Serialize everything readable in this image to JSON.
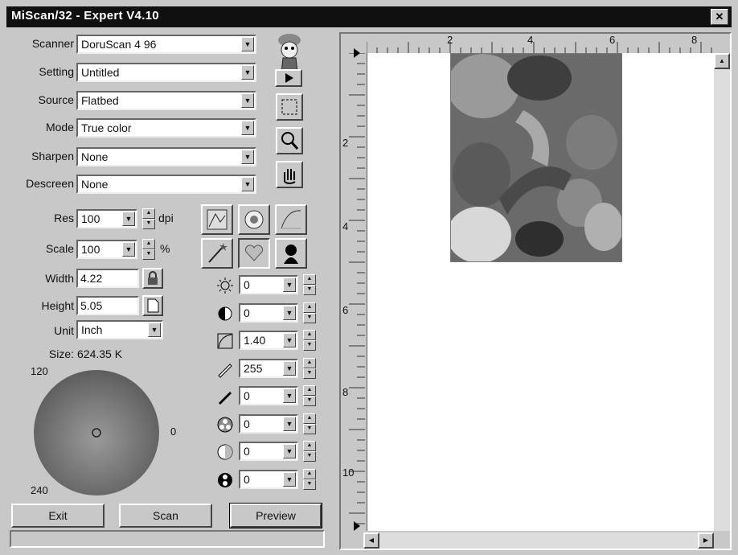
{
  "window": {
    "title": "MiScan/32 - Expert V4.10",
    "close_glyph": "✕"
  },
  "form": {
    "scanner": {
      "label": "Scanner",
      "value": "DoruScan 4 96"
    },
    "setting": {
      "label": "Setting",
      "value": "Untitled"
    },
    "source": {
      "label": "Source",
      "value": "Flatbed"
    },
    "mode": {
      "label": "Mode",
      "value": "True color"
    },
    "sharpen": {
      "label": "Sharpen",
      "value": "None"
    },
    "descreen": {
      "label": "Descreen",
      "value": "None"
    },
    "res": {
      "label": "Res",
      "value": "100",
      "unit": "dpi"
    },
    "scale": {
      "label": "Scale",
      "value": "100",
      "unit": "%"
    },
    "width": {
      "label": "Width",
      "value": "4.22"
    },
    "height": {
      "label": "Height",
      "value": "5.05"
    },
    "unit": {
      "label": "Unit",
      "value": "Inch"
    },
    "size": {
      "label": "Size:",
      "value": "624.35 K"
    }
  },
  "color_wheel": {
    "label_120": "120",
    "label_0": "0",
    "label_240": "240"
  },
  "adjustments": [
    {
      "icon": "brightness-icon",
      "value": "0"
    },
    {
      "icon": "contrast-icon",
      "value": "0"
    },
    {
      "icon": "gamma-icon",
      "value": "1.40"
    },
    {
      "icon": "white-point-icon",
      "value": "255"
    },
    {
      "icon": "black-point-icon",
      "value": "0"
    },
    {
      "icon": "saturation-icon",
      "value": "0"
    },
    {
      "icon": "hue-icon",
      "value": "0"
    },
    {
      "icon": "color-balance-icon",
      "value": "0"
    }
  ],
  "buttons": {
    "exit": "Exit",
    "scan": "Scan",
    "preview": "Preview"
  },
  "ruler": {
    "h_labels": [
      "2",
      "4",
      "6",
      "8"
    ],
    "v_labels": [
      "2",
      "4",
      "6",
      "8",
      "10"
    ]
  },
  "colors": {
    "titlebar": "#101010",
    "face": "#c8c8c8",
    "canvas": "#ffffff"
  }
}
